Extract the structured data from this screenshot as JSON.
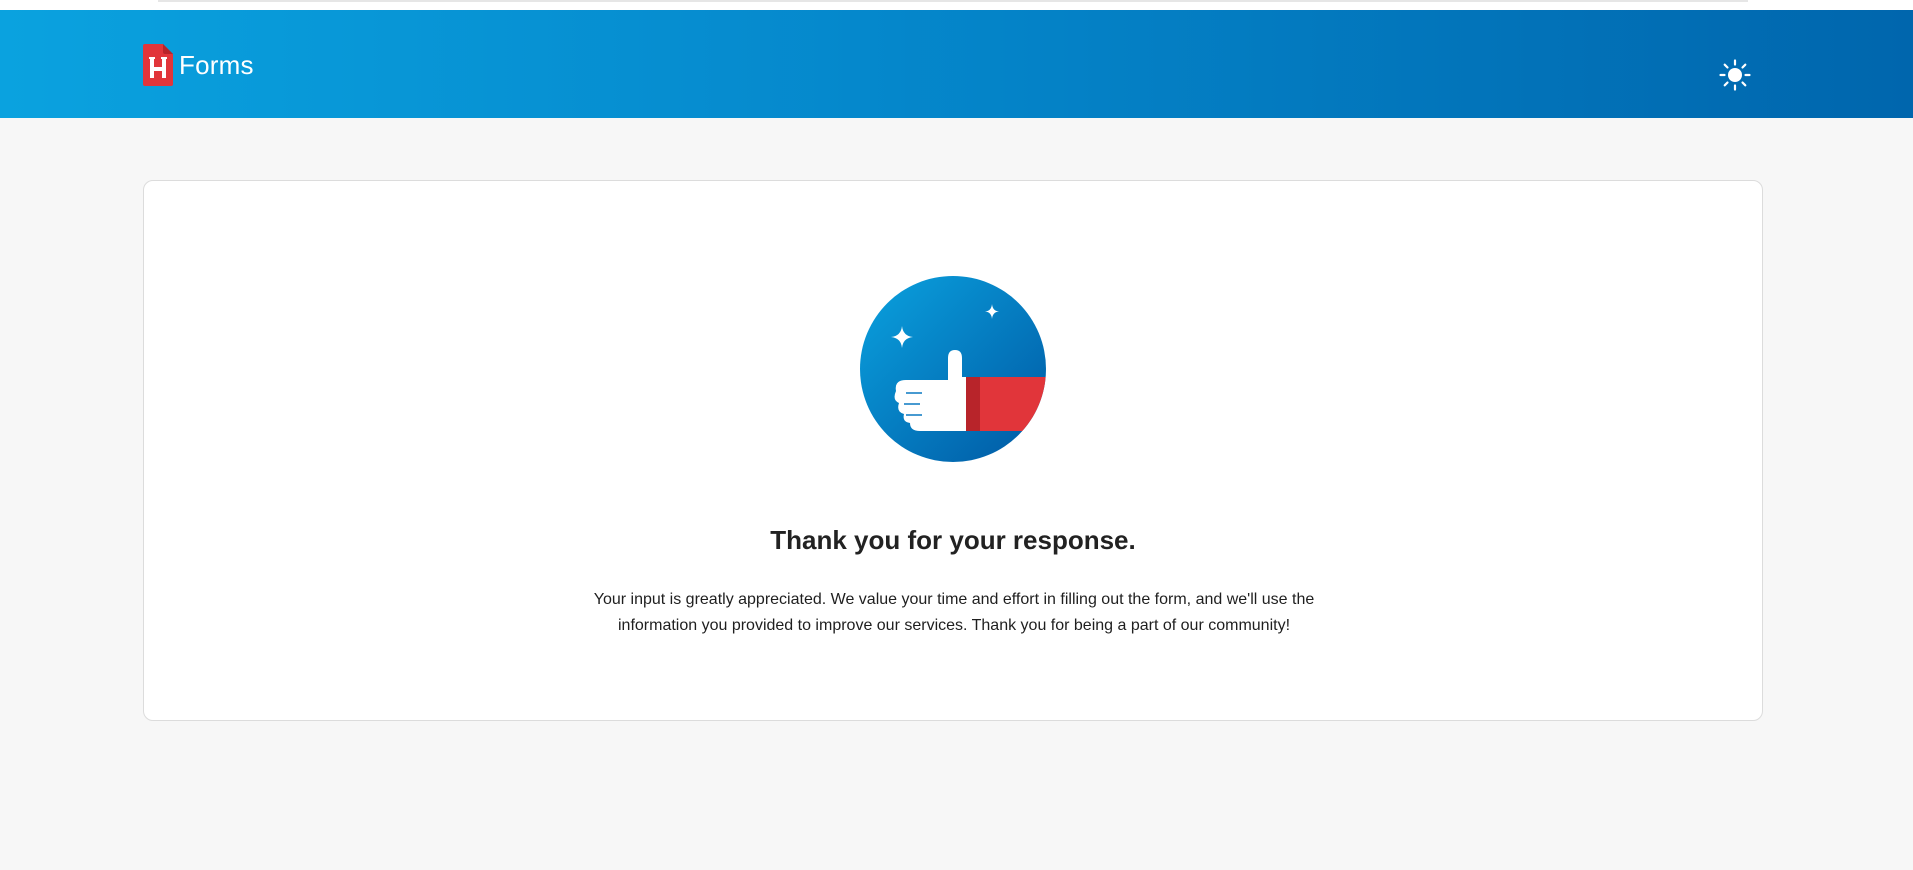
{
  "header": {
    "brand_name": "Forms",
    "logo_icon": "h-forms-logo-icon",
    "theme_toggle_icon": "sun-icon"
  },
  "confirmation": {
    "illustration_icon": "thumbs-up-icon",
    "title": "Thank you for your response.",
    "message": "Your input is greatly appreciated. We value your time and effort in filling out the form, and we'll use the information you provided to improve our services. Thank you for being a part of our community!"
  },
  "colors": {
    "header_gradient_start": "#0aa2df",
    "header_gradient_end": "#0066ad",
    "brand_red": "#e1353a",
    "page_background": "#f7f7f7",
    "card_background": "#ffffff"
  }
}
